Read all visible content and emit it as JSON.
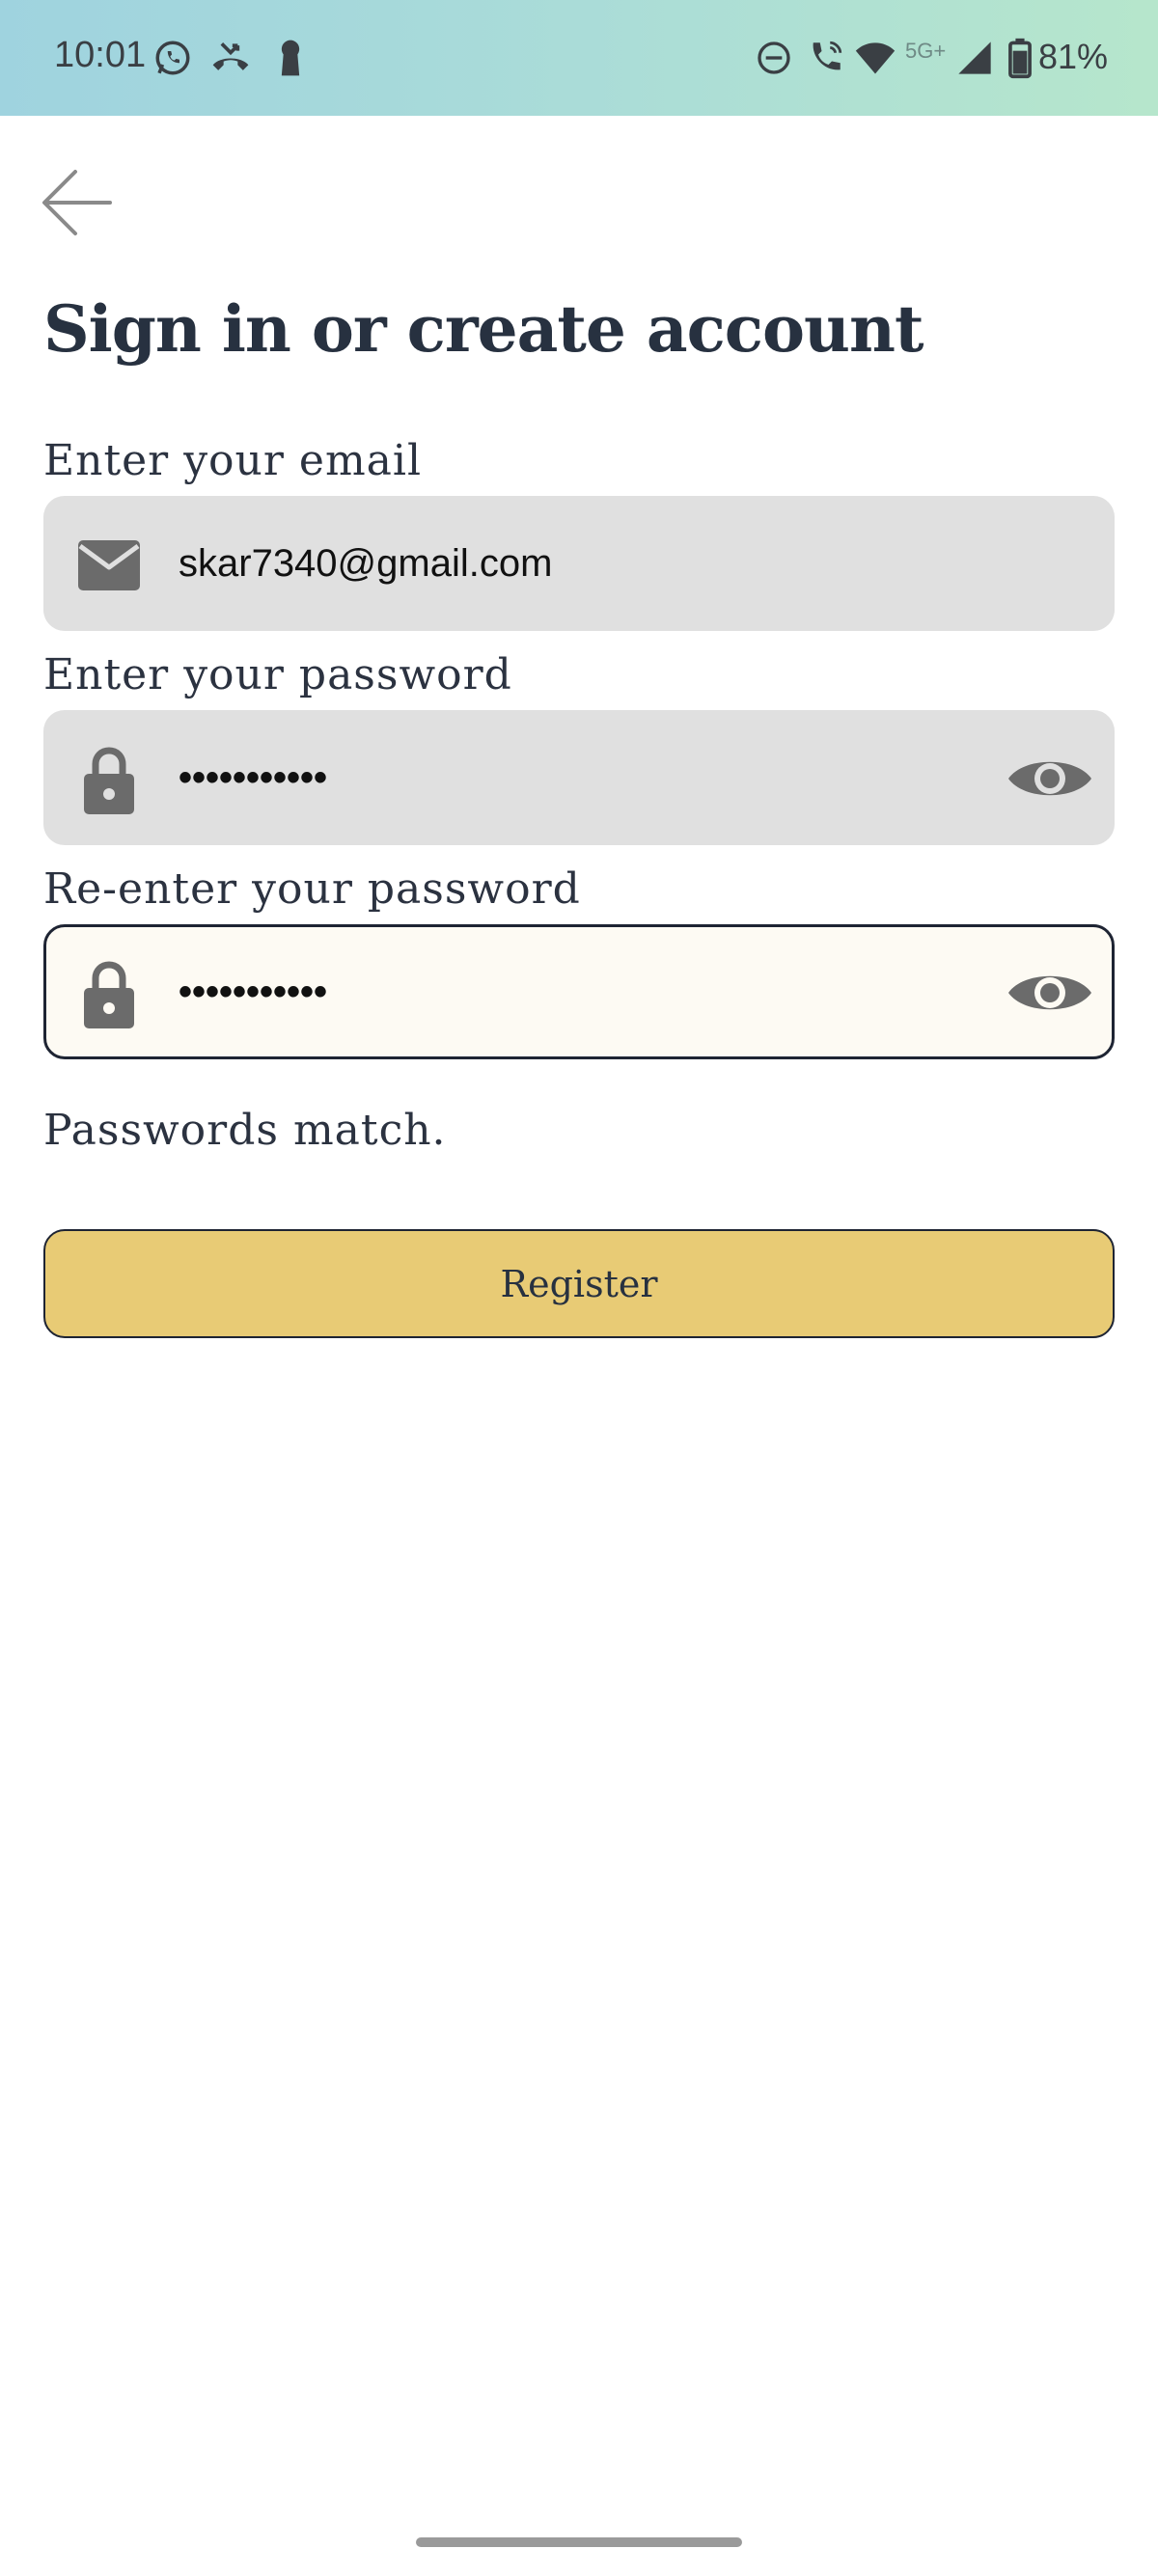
{
  "status_bar": {
    "time": "10:01",
    "network_label": "5G+",
    "battery_percent": "81%",
    "left_icons": [
      "whatsapp-icon",
      "missed-call-icon",
      "keyhole-icon"
    ],
    "right_icons": [
      "do-not-disturb-icon",
      "wifi-calling-icon",
      "wifi-icon",
      "signal-icon",
      "battery-icon"
    ]
  },
  "header": {
    "back_icon": "arrow-left-icon",
    "title": "Sign in or create account"
  },
  "form": {
    "email": {
      "label": "Enter your email",
      "value": "skar7340@gmail.com",
      "icon": "mail-icon"
    },
    "password": {
      "label": "Enter your password",
      "value": "•••••••••••",
      "icon": "lock-icon",
      "toggle_icon": "eye-icon"
    },
    "confirm_password": {
      "label": "Re-enter your password",
      "value": "•••••••••••",
      "icon": "lock-icon",
      "toggle_icon": "eye-icon"
    },
    "status_message": "Passwords match.",
    "submit_label": "Register"
  },
  "colors": {
    "accent": "#e8cb75",
    "field_bg": "#e0e0e0",
    "active_field_bg": "#fdfaf3",
    "text": "#273140"
  }
}
